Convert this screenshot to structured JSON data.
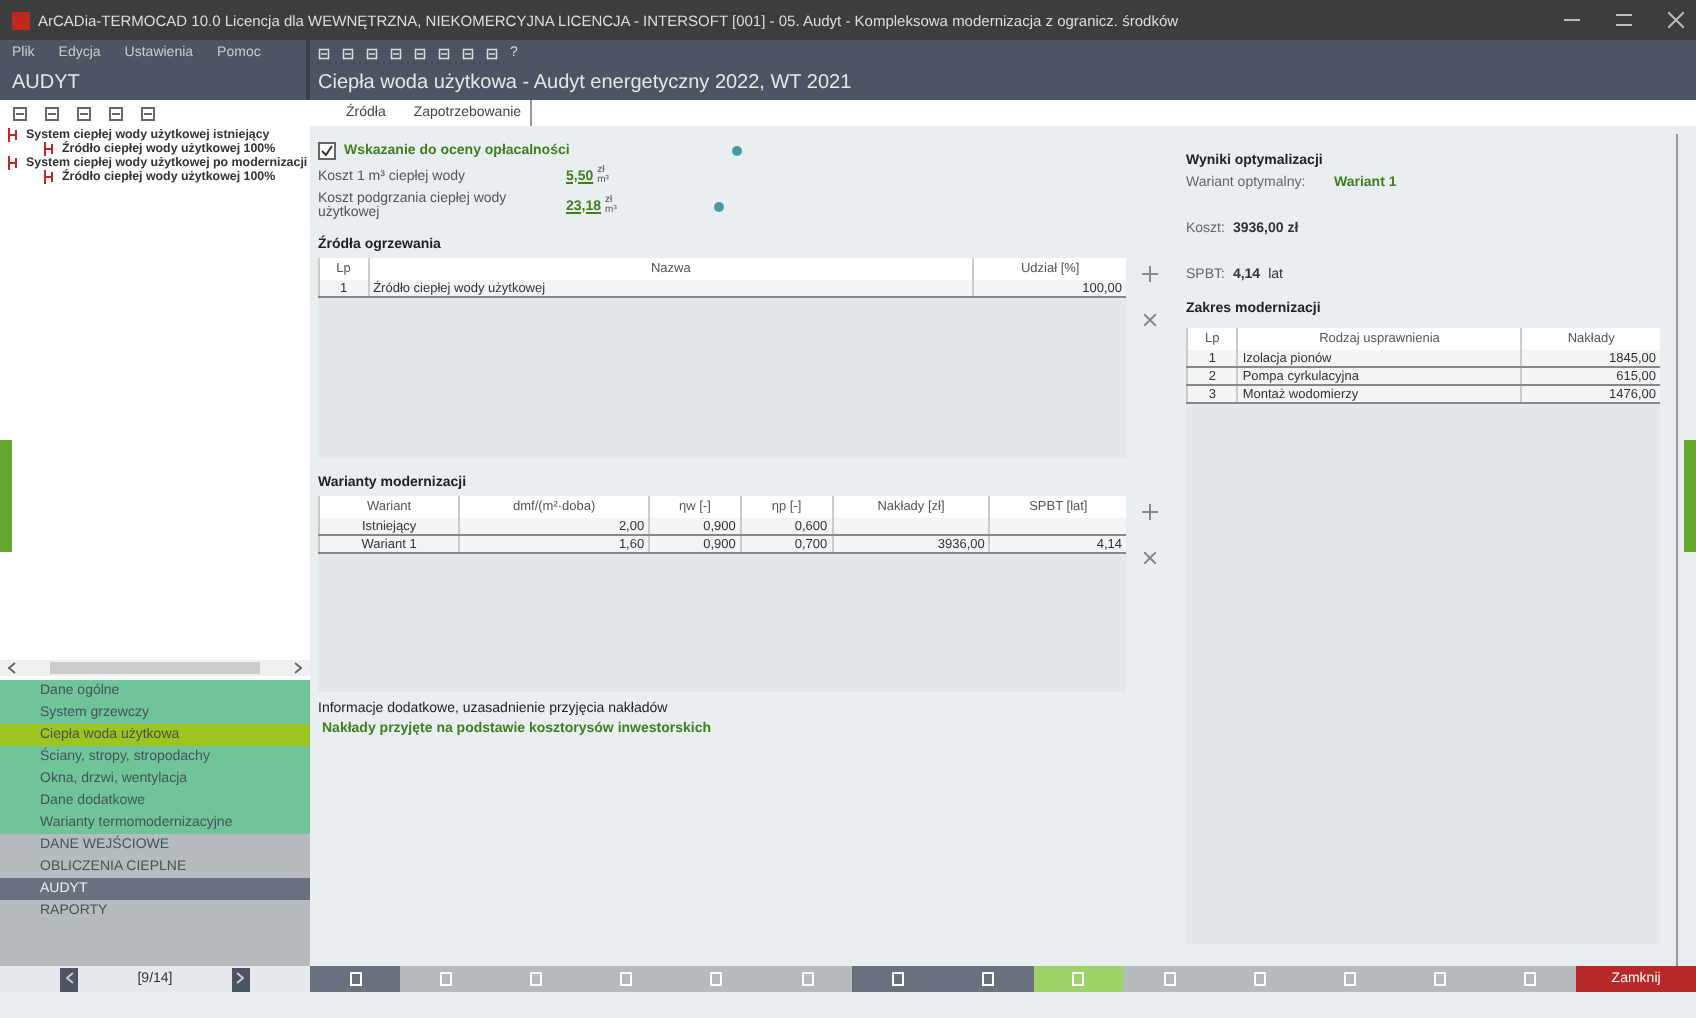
{
  "window": {
    "title": "ArCADia-TERMOCAD 10.0 Licencja dla WEWNĘTRZNA, NIEKOMERCYJNA LICENCJA - INTERSOFT [001] - 05. Audyt - Kompleksowa modernizacja z ogranicz. środków"
  },
  "menu": [
    "Plik",
    "Edycja",
    "Ustawienia",
    "Pomoc"
  ],
  "module_title": "AUDYT",
  "toolbar_help": "?",
  "page_title": "Ciepła woda użytkowa - Audyt energetyczny 2022, WT 2021",
  "tree": [
    {
      "label": "System ciepłej wody użytkowej istniejący",
      "children": [
        {
          "label": "Źródło ciepłej wody użytkowej 100%"
        }
      ]
    },
    {
      "label": "System ciepłej wody użytkowej po modernizacji",
      "children": [
        {
          "label": "Źródło ciepłej wody użytkowej 100%"
        }
      ]
    }
  ],
  "nav": [
    {
      "label": "Dane ogólne",
      "kind": "section",
      "selected": false
    },
    {
      "label": "System grzewczy",
      "kind": "section",
      "selected": false
    },
    {
      "label": "Ciepła woda użytkowa",
      "kind": "section",
      "selected": true
    },
    {
      "label": "Ściany, stropy, stropodachy",
      "kind": "section",
      "selected": false
    },
    {
      "label": "Okna, drzwi, wentylacja",
      "kind": "section",
      "selected": false
    },
    {
      "label": "Dane dodatkowe",
      "kind": "section",
      "selected": false
    },
    {
      "label": "Warianty termomodernizacyjne",
      "kind": "section",
      "selected": false
    },
    {
      "label": "DANE WEJŚCIOWE",
      "kind": "module",
      "selected": false
    },
    {
      "label": "OBLICZENIA CIEPLNE",
      "kind": "module",
      "selected": false
    },
    {
      "label": "AUDYT",
      "kind": "module",
      "selected": true
    },
    {
      "label": "RAPORTY",
      "kind": "module",
      "selected": false
    }
  ],
  "pager": {
    "label": "[9/14]"
  },
  "tabs": [
    {
      "label": "Źródła",
      "selected": false
    },
    {
      "label": "Zapotrzebowanie",
      "selected": true
    }
  ],
  "profitability": {
    "label": "Wskazanie do oceny opłacalności",
    "checked": true
  },
  "costs": [
    {
      "label": "Koszt 1 m³ ciepłej wody",
      "value": "5,50",
      "unit_top": "zł",
      "unit_bottom": "m³"
    },
    {
      "label": "Koszt podgrzania ciepłej wody użytkowej",
      "value": "23,18",
      "unit_top": "zł",
      "unit_bottom": "m³"
    }
  ],
  "sources": {
    "title": "Źródła ogrzewania",
    "columns": [
      "Lp",
      "Nazwa",
      "Udział [%]"
    ],
    "rows": [
      [
        "1",
        "Źródło ciepłej wody użytkowej",
        "100,00"
      ]
    ]
  },
  "variants": {
    "title": "Warianty modernizacji",
    "columns": [
      "Wariant",
      "dmf/(m²·doba)",
      "ηw [-]",
      "ηp [-]",
      "Nakłady [zł]",
      "SPBT [lat]"
    ],
    "rows": [
      [
        "Istniejący",
        "2,00",
        "0,900",
        "0,600",
        "",
        ""
      ],
      [
        "Wariant 1",
        "1,60",
        "0,900",
        "0,700",
        "3936,00",
        "4,14"
      ]
    ]
  },
  "info": {
    "title": "Informacje dodatkowe, uzasadnienie przyjęcia nakładów",
    "text": "Nakłady przyjęte na podstawie kosztorysów inwestorskich"
  },
  "results": {
    "title": "Wyniki optymalizacji",
    "optimal_label": "Wariant optymalny:",
    "optimal_value": "Wariant 1",
    "cost_label": "Koszt:",
    "cost_value": "3936,00 zł",
    "spbt_label": "SPBT:",
    "spbt_value": "4,14",
    "spbt_unit": "lat"
  },
  "scope": {
    "title": "Zakres modernizacji",
    "columns": [
      "Lp",
      "Rodzaj usprawnienia",
      "Nakłady"
    ],
    "rows": [
      [
        "1",
        "Izolacja pionów",
        "1845,00"
      ],
      [
        "2",
        "Pompa cyrkulacyjna",
        "615,00"
      ],
      [
        "3",
        "Montaż wodomierzy",
        "1476,00"
      ]
    ]
  },
  "bottom_buttons": [
    {
      "kind": "dark"
    },
    {
      "kind": "grey"
    },
    {
      "kind": "grey"
    },
    {
      "kind": "grey"
    },
    {
      "kind": "grey"
    },
    {
      "kind": "grey"
    },
    {
      "kind": "dark"
    },
    {
      "kind": "dark"
    },
    {
      "kind": "green"
    },
    {
      "kind": "grey"
    },
    {
      "kind": "grey"
    },
    {
      "kind": "grey"
    },
    {
      "kind": "grey"
    },
    {
      "kind": "grey"
    }
  ],
  "close_button": "Zamknij"
}
